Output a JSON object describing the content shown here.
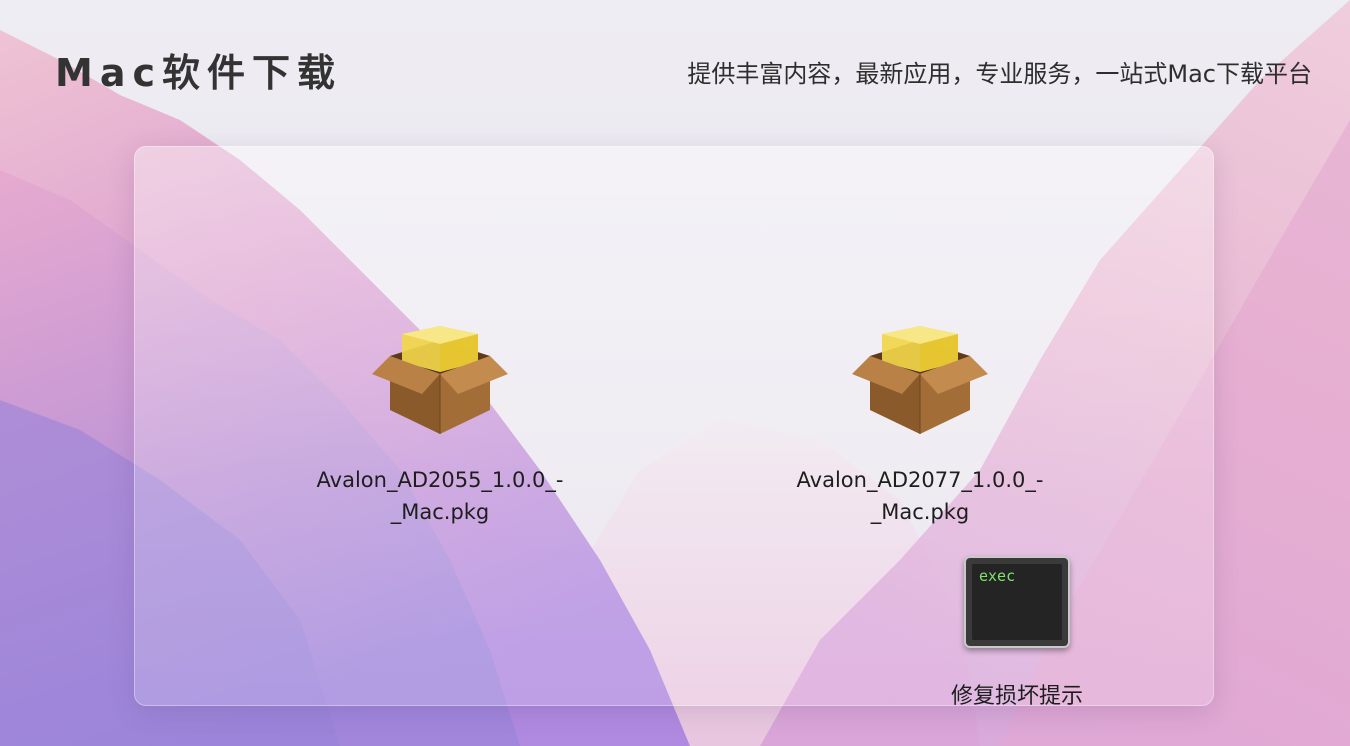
{
  "header": {
    "site_title": "Mac软件下载",
    "tagline": "提供丰富内容，最新应用，专业服务，一站式Mac下载平台"
  },
  "window": {
    "files": [
      {
        "name": "Avalon_AD2055_1.0.0_-_Mac.pkg",
        "icon": "package-icon"
      },
      {
        "name": "Avalon_AD2077_1.0.0_-_Mac.pkg",
        "icon": "package-icon"
      }
    ],
    "exec_item": {
      "icon_text": "exec",
      "label": "修复损坏提示",
      "icon": "terminal-exec-icon"
    }
  },
  "colors": {
    "bg_top": "#eceaf2",
    "bg_pink": "#e4a8cc",
    "bg_purple": "#a58bd8",
    "exec_green": "#7ee36a"
  }
}
